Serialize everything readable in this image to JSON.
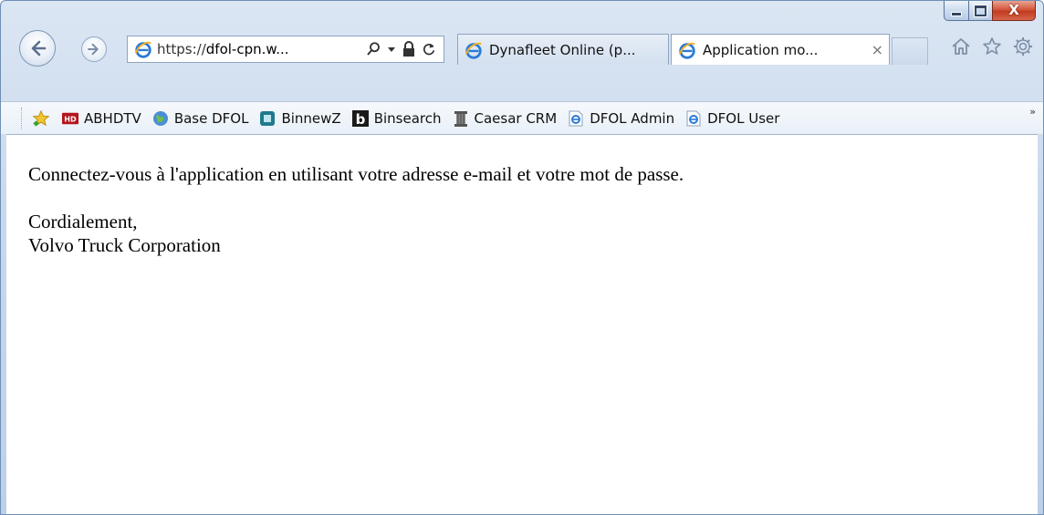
{
  "window": {
    "title": "",
    "close_glyph": "X"
  },
  "nav": {
    "address_prefix": "https://",
    "address_host": "dfol-cpn.w...",
    "icons": [
      "back-arrow-icon",
      "forward-arrow-icon",
      "ie-logo-icon",
      "search-icon",
      "dropdown-icon",
      "lock-icon",
      "refresh-icon",
      "home-icon",
      "favorites-star-icon",
      "gear-icon"
    ]
  },
  "tabs": [
    {
      "label": "Dynafleet Online (p...",
      "active": false
    },
    {
      "label": "Application mo...",
      "active": true,
      "close": "×"
    }
  ],
  "favorites": [
    {
      "label": "ABHDTV",
      "icon": "hd-icon"
    },
    {
      "label": "Base DFOL",
      "icon": "globe-icon"
    },
    {
      "label": "BinnewZ",
      "icon": "binnewz-icon"
    },
    {
      "label": "Binsearch",
      "icon": "b-icon"
    },
    {
      "label": "Caesar CRM",
      "icon": "pillar-icon"
    },
    {
      "label": "DFOL Admin",
      "icon": "ie-page-icon"
    },
    {
      "label": "DFOL User",
      "icon": "ie-page-icon"
    }
  ],
  "favorites_overflow": "»",
  "content": {
    "line1": "Connectez-vous à l'application en utilisant votre adresse e-mail et votre mot de passe.",
    "line2": "Cordialement,",
    "line3": "Volvo Truck Corporation"
  },
  "colors": {
    "chrome": "#c9d9ec",
    "close_button": "#c23a1f",
    "ie_blue": "#2a7ad8"
  }
}
